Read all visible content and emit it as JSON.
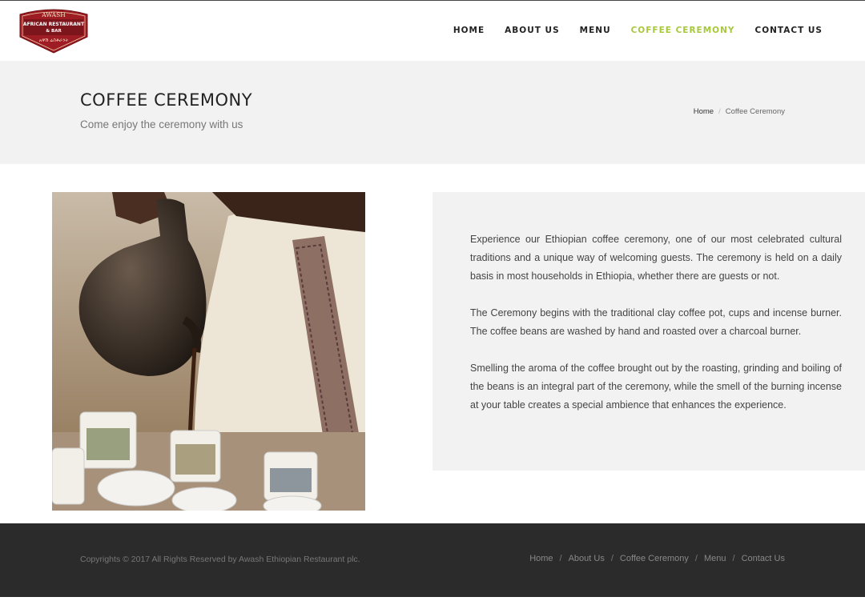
{
  "brand": {
    "logo_top": "AWASH",
    "logo_mid1": "AFRICAN RESTAURANT",
    "logo_mid2": "& BAR",
    "logo_amharic": "አዋሽ ሬስቶራንት"
  },
  "nav": {
    "items": [
      {
        "label": "HOME",
        "active": false
      },
      {
        "label": "ABOUT US",
        "active": false
      },
      {
        "label": "MENU",
        "active": false
      },
      {
        "label": "COFFEE CEREMONY",
        "active": true
      },
      {
        "label": "CONTACT US",
        "active": false
      }
    ]
  },
  "hero": {
    "title": "COFFEE CEREMONY",
    "subtitle": "Come enjoy the ceremony with us",
    "breadcrumb": {
      "home": "Home",
      "sep": "/",
      "current": "Coffee Ceremony"
    }
  },
  "content": {
    "paragraphs": [
      "Experience our Ethiopian coffee ceremony, one of our most celebrated cultural traditions and a unique way of welcoming guests. The ceremony is held on a daily basis in most households in Ethiopia, whether there are guests or not.",
      "The Ceremony begins with the traditional clay coffee pot, cups and incense burner. The coffee beans are washed by hand and roasted over a charcoal burner.",
      "Smelling the aroma of the coffee brought out by the roasting, grinding and boiling of the beans is an integral part of the ceremony, while the smell of the burning incense at your table creates a special ambience that enhances the experience."
    ]
  },
  "footer": {
    "copyright": "Copyrights © 2017 All Rights Reserved by Awash Ethiopian Restaurant plc.",
    "links": [
      "Home",
      "About Us",
      "Coffee Ceremony",
      "Menu",
      "Contact Us"
    ],
    "sep": "/"
  },
  "colors": {
    "accent": "#a8c83c",
    "logo_red": "#9e1c24",
    "footer_bg": "#2b2b2b",
    "band_bg": "#f2f2f2"
  }
}
